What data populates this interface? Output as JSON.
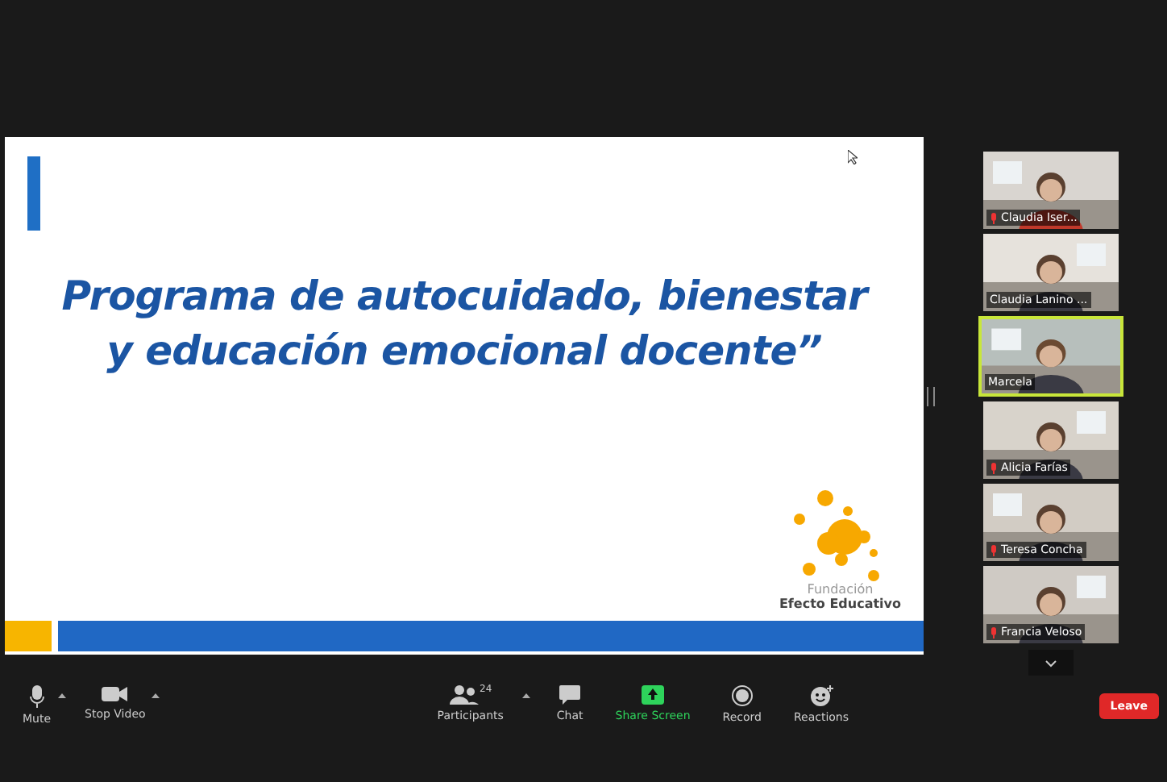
{
  "slide": {
    "title_lines": [
      "Programa de autocuidado, bienestar",
      "y educación emocional docente”"
    ],
    "logo": {
      "line_1": "Fundación",
      "line_2": "Efecto Educativo"
    }
  },
  "participants": [
    {
      "name": "Claudia Iser...",
      "muted": true,
      "selected": false
    },
    {
      "name": "Claudia Lanino ...",
      "muted": false,
      "selected": false
    },
    {
      "name": "Marcela",
      "muted": false,
      "selected": true
    },
    {
      "name": "Alicia Farías",
      "muted": true,
      "selected": false
    },
    {
      "name": "Teresa Concha",
      "muted": true,
      "selected": false
    },
    {
      "name": "Francia Veloso",
      "muted": true,
      "selected": false
    }
  ],
  "toolbar": {
    "left": [
      {
        "kind": "mic",
        "label": "Mute"
      },
      {
        "kind": "video",
        "label": "Stop Video"
      }
    ],
    "center": [
      {
        "kind": "participants",
        "label": "Participants",
        "count": "24"
      },
      {
        "kind": "chat",
        "label": "Chat"
      },
      {
        "kind": "share",
        "label": "Share Screen"
      },
      {
        "kind": "record",
        "label": "Record"
      },
      {
        "kind": "reactions",
        "label": "Reactions"
      }
    ],
    "leave": "Leave"
  }
}
